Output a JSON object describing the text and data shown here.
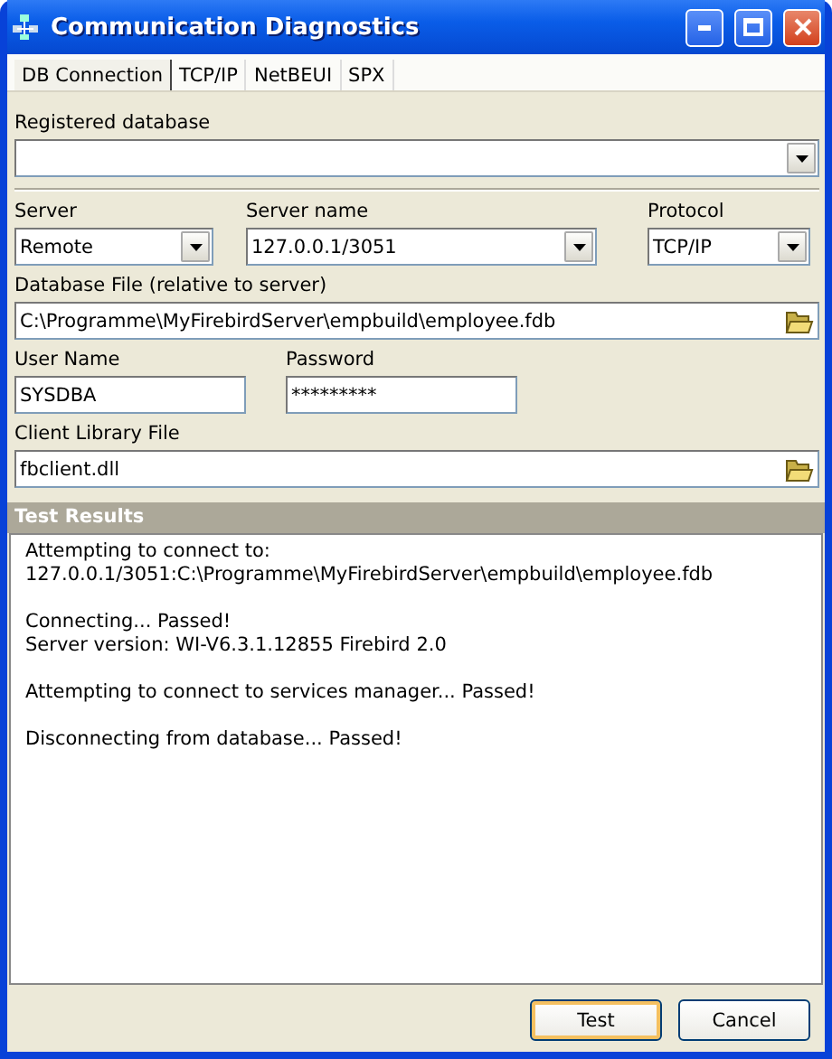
{
  "window": {
    "title": "Communication Diagnostics"
  },
  "tabs": [
    {
      "label": "DB Connection",
      "selected": true
    },
    {
      "label": "TCP/IP",
      "selected": false
    },
    {
      "label": "NetBEUI",
      "selected": false
    },
    {
      "label": "SPX",
      "selected": false
    }
  ],
  "registered_database": {
    "label": "Registered database"
  },
  "server": {
    "label": "Server",
    "value": "Remote"
  },
  "server_name": {
    "label": "Server name",
    "value": "127.0.0.1/3051"
  },
  "protocol": {
    "label": "Protocol",
    "value": "TCP/IP"
  },
  "database_file": {
    "label": "Database File (relative to server)",
    "value": "C:\\Programme\\MyFirebirdServer\\empbuild\\employee.fdb"
  },
  "user_name": {
    "label": "User Name",
    "value": "SYSDBA"
  },
  "password": {
    "label": "Password",
    "value": "*********"
  },
  "client_library": {
    "label": "Client Library File",
    "value": "fbclient.dll"
  },
  "test_results": {
    "title": "Test Results",
    "paragraphs": [
      [
        "Attempting to connect to:",
        "127.0.0.1/3051:C:\\Programme\\MyFirebirdServer\\empbuild\\employee.fdb"
      ],
      [
        "Connecting... Passed!",
        "Server version: WI-V6.3.1.12855 Firebird 2.0"
      ],
      [
        "Attempting to connect to services manager... Passed!"
      ],
      [
        "Disconnecting from database... Passed!"
      ]
    ]
  },
  "buttons": [
    {
      "label": "Test",
      "default": true
    },
    {
      "label": "Cancel",
      "default": false
    }
  ]
}
